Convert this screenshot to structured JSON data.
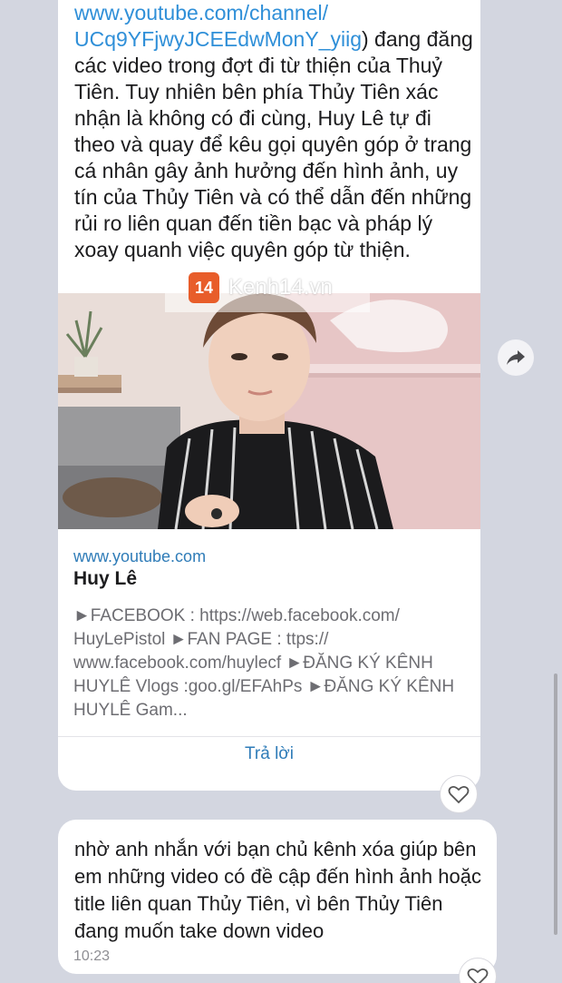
{
  "message1": {
    "text_link": "www.youtube.com/channel/\nUCq9YFjwyJCEEdwMonY_yiig",
    "text_body": ") đang đăng các video trong đợt đi từ thiện của Thuỷ Tiên. Tuy nhiên bên phía Thủy Tiên xác nhận là không có đi cùng, Huy Lê tự đi theo và quay để kêu gọi quyên góp ở trang cá nhân gây ảnh hưởng đến hình ảnh, uy tín của Thủy Tiên và có thể dẫn đến những rủi ro liên quan đến tiền bạc và pháp lý xoay quanh việc quyên góp từ thiện."
  },
  "watermark": {
    "badge": "14",
    "text": "Kenh14.vn"
  },
  "link_preview": {
    "domain": "www.youtube.com",
    "title": "Huy Lê",
    "description": "►FACEBOOK : https://web.facebook.com/ HuyLePistol ►FAN PAGE : ttps:// www.facebook.com/huylecf ►ĐĂNG KÝ KÊNH HUYLÊ Vlogs :goo.gl/EFAhPs ►ĐĂNG KÝ KÊNH HUYLÊ Gam..."
  },
  "reply_label": "Trả lời",
  "message2": {
    "text": "nhờ anh nhắn với bạn chủ kênh xóa giúp bên em những video có đề cập đến hình ảnh hoặc title liên quan Thủy Tiên, vì bên Thủy Tiên đang muốn take down video",
    "time": "10:23"
  },
  "icons": {
    "heart": "heart-icon",
    "share": "share-arrow-icon"
  },
  "colors": {
    "background": "#d3d6e0",
    "bubble": "#ffffff",
    "link": "#2f8fd8"
  }
}
